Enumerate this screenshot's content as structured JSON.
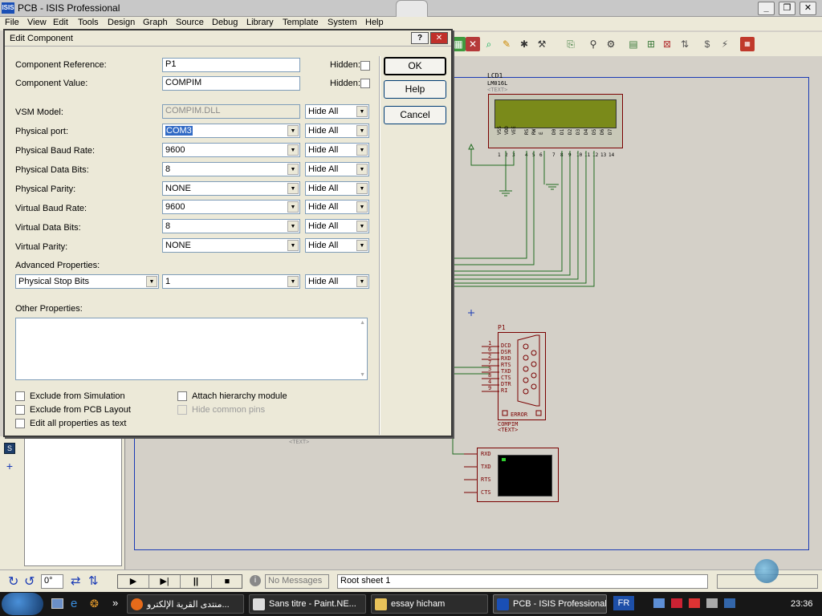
{
  "app": {
    "title": "PCB - ISIS Professional",
    "icon_label": "ISIS"
  },
  "menu": [
    "File",
    "View",
    "Edit",
    "Tools",
    "Design",
    "Graph",
    "Source",
    "Debug",
    "Library",
    "Template",
    "System",
    "Help"
  ],
  "dialog": {
    "title": "Edit Component",
    "help_glyph": "?",
    "close_glyph": "✕",
    "component_reference_label": "Component Reference:",
    "component_reference_value": "P1",
    "component_value_label": "Component Value:",
    "component_value_value": "COMPIM",
    "hidden_label": "Hidden:",
    "properties": [
      {
        "label": "VSM Model:",
        "value": "COMPIM.DLL",
        "visibility": "Hide All"
      },
      {
        "label": "Physical port:",
        "value": "COM3",
        "visibility": "Hide All"
      },
      {
        "label": "Physical Baud Rate:",
        "value": "9600",
        "visibility": "Hide All"
      },
      {
        "label": "Physical Data Bits:",
        "value": "8",
        "visibility": "Hide All"
      },
      {
        "label": "Physical Parity:",
        "value": "NONE",
        "visibility": "Hide All"
      },
      {
        "label": "Virtual Baud Rate:",
        "value": "9600",
        "visibility": "Hide All"
      },
      {
        "label": "Virtual Data Bits:",
        "value": "8",
        "visibility": "Hide All"
      },
      {
        "label": "Virtual Parity:",
        "value": "NONE",
        "visibility": "Hide All"
      }
    ],
    "advanced_label": "Advanced Properties:",
    "advanced_property": "Physical Stop Bits",
    "advanced_value": "1",
    "advanced_visibility": "Hide All",
    "other_properties_label": "Other Properties:",
    "checkboxes": {
      "exclude_sim": "Exclude from Simulation",
      "exclude_pcb": "Exclude from PCB Layout",
      "edit_all": "Edit all properties as text",
      "attach_hier": "Attach hierarchy module",
      "hide_common": "Hide common pins"
    },
    "buttons": {
      "ok": "OK",
      "help": "Help",
      "cancel": "Cancel"
    }
  },
  "schematic": {
    "lcd_ref": "LCD1",
    "lcd_part": "LM016L",
    "text_placeholder": "<TEXT>",
    "lcd_pins": [
      "VSS",
      "VDD",
      "VEE",
      "RS",
      "RW",
      "E",
      "D0",
      "D1",
      "D2",
      "D3",
      "D4",
      "D5",
      "D6",
      "D7"
    ],
    "lcd_pin_numbers": [
      "1",
      "2",
      "3",
      "4",
      "5",
      "6",
      "7",
      "8",
      "9",
      "10",
      "11",
      "12",
      "13",
      "14"
    ],
    "port_ref": "P1",
    "port_part": "COMPIM",
    "port_pins": [
      "DCD",
      "DSR",
      "RXD",
      "RTS",
      "TXD",
      "CTS",
      "DTR",
      "RI"
    ],
    "port_pin_numbers": [
      "1",
      "6",
      "2",
      "7",
      "3",
      "8",
      "4",
      "9"
    ],
    "port_error": "ERROR",
    "terminal_pins": [
      "RXD",
      "TXD",
      "RTS",
      "CTS"
    ]
  },
  "statusbar": {
    "rotation": "0°",
    "messages": "No Messages",
    "sheet": "Root sheet 1",
    "clock": "23:36"
  },
  "taskbar": {
    "tasks": [
      "منتدى القرية الإلكترو...",
      "Sans titre - Paint.NE...",
      "essay hicham",
      "PCB - ISIS Professional"
    ],
    "lang": "FR",
    "quick_launch_arrow": "»"
  }
}
